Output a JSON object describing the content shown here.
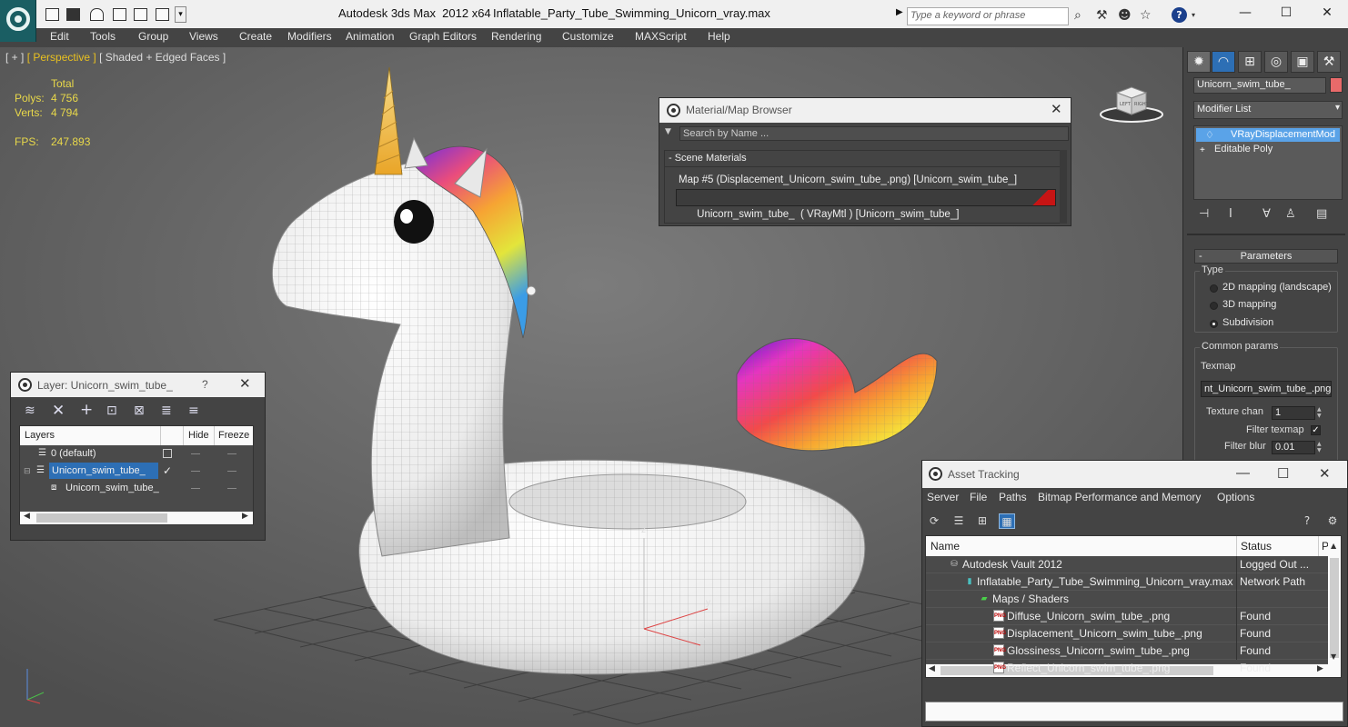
{
  "app": {
    "title": "Autodesk 3ds Max  2012 x64",
    "file": "Inflatable_Party_Tube_Swimming_Unicorn_vray.max",
    "search_placeholder": "Type a keyword or phrase"
  },
  "menu": [
    "Edit",
    "Tools",
    "Group",
    "Views",
    "Create",
    "Modifiers",
    "Animation",
    "Graph Editors",
    "Rendering",
    "Customize",
    "MAXScript",
    "Help"
  ],
  "viewport": {
    "label_plus": "[ + ]",
    "label_view": "[ Perspective ]",
    "label_shading": "[ Shaded + Edged Faces ]",
    "stats_header": "Total",
    "polys_label": "Polys:",
    "polys_value": "4 756",
    "verts_label": "Verts:",
    "verts_value": "4 794",
    "fps_label": "FPS:",
    "fps_value": "247.893",
    "axis_z": "z",
    "axis_y": "y",
    "axis_x": "x",
    "viewcube_left": "LEFT",
    "viewcube_right": "RIGHT"
  },
  "command_panel": {
    "object_name": "Unicorn_swim_tube_",
    "object_color": "#e96a6a",
    "modifier_list": "Modifier List",
    "stack": [
      "VRayDisplacementMod",
      "Editable Poly"
    ],
    "rollout_title": "Parameters",
    "type_label": "Type",
    "type_options": [
      "2D mapping (landscape)",
      "3D mapping",
      "Subdivision"
    ],
    "type_selected": 2,
    "common_params_label": "Common params",
    "texmap_label": "Texmap",
    "texmap_value": "nt_Unicorn_swim_tube_.png)",
    "texture_chan_label": "Texture chan",
    "texture_chan_value": "1",
    "filter_texmap_label": "Filter texmap",
    "filter_texmap_checked": true,
    "filter_blur_label": "Filter blur",
    "filter_blur_value": "0.01"
  },
  "material_browser": {
    "title": "Material/Map Browser",
    "search_placeholder": "Search by Name ...",
    "group": "- Scene Materials",
    "rows": [
      "Map #5 (Displacement_Unicorn_swim_tube_.png) [Unicorn_swim_tube_]",
      "Unicorn_swim_tube_  ( VRayMtl ) [Unicorn_swim_tube_]"
    ],
    "swatch_color": "#c71414"
  },
  "layer_window": {
    "title": "Layer: Unicorn_swim_tube_",
    "help": "?",
    "col_layers": "Layers",
    "col_hide": "Hide",
    "col_freeze": "Freeze",
    "rows": [
      "0 (default)",
      "Unicorn_swim_tube_",
      "Unicorn_swim_tube_"
    ]
  },
  "asset_tracking": {
    "title": "Asset Tracking",
    "menus": [
      "Server",
      "File",
      "Paths",
      "Bitmap Performance and Memory",
      "Options"
    ],
    "col_name": "Name",
    "col_status": "Status",
    "col_p": "P",
    "rows": [
      {
        "name": "Autodesk Vault 2012",
        "status": "Logged Out ..."
      },
      {
        "name": "Inflatable_Party_Tube_Swimming_Unicorn_vray.max",
        "status": "Network Path"
      },
      {
        "name": "Maps / Shaders",
        "status": ""
      },
      {
        "name": "Diffuse_Unicorn_swim_tube_.png",
        "status": "Found"
      },
      {
        "name": "Displacement_Unicorn_swim_tube_.png",
        "status": "Found"
      },
      {
        "name": "Glossiness_Unicorn_swim_tube_.png",
        "status": "Found"
      },
      {
        "name": "Reflect_Unicorn_swim_tube_.png",
        "status": "Found"
      }
    ]
  }
}
